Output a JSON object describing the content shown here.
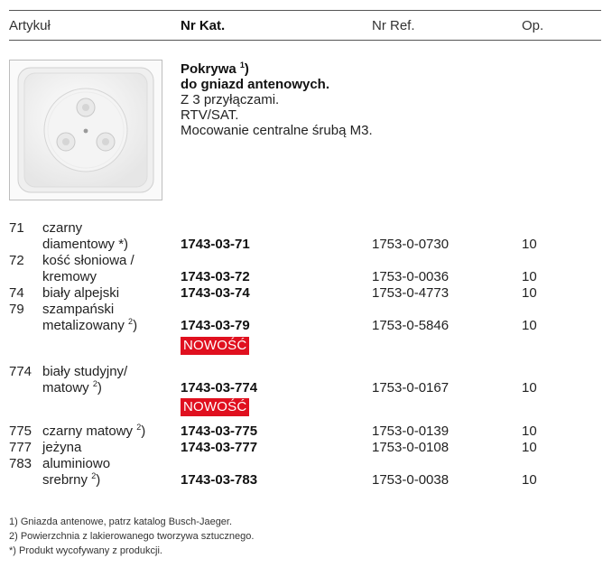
{
  "header": {
    "col_article": "Artykuł",
    "col_cat": "Nr Kat.",
    "col_ref": "Nr Ref.",
    "col_op": "Op."
  },
  "product": {
    "title": "Pokrywa",
    "title_sup": "1",
    "title_paren": ")",
    "subtitle": "do gniazd antenowych.",
    "line1": "Z 3 przyłączami.",
    "line2": "RTV/SAT.",
    "line3": "Mocowanie centralne śrubą M3."
  },
  "rows": [
    {
      "num": "71",
      "name1": "czarny",
      "name2": "diamentowy *)",
      "cat": "1743-03-71",
      "ref": "1753-0-0730",
      "op": "10"
    },
    {
      "num": "72",
      "name1": "kość słoniowa /",
      "name2": "kremowy",
      "cat": "1743-03-72",
      "ref": "1753-0-0036",
      "op": "10"
    },
    {
      "num": "74",
      "name1": "biały alpejski",
      "cat": "1743-03-74",
      "ref": "1753-0-4773",
      "op": "10"
    },
    {
      "num": "79",
      "name1": "szampański",
      "name2": "metalizowany",
      "name2_sup": "2",
      "name2_after": ")",
      "cat": "1743-03-79",
      "ref": "1753-0-5846",
      "op": "10"
    },
    {
      "num": "774",
      "name1": "biały studyjny/",
      "name2": "matowy",
      "name2_sup": "2",
      "name2_after": ")",
      "cat": "1743-03-774",
      "ref": "1753-0-0167",
      "op": "10"
    },
    {
      "num": "775",
      "name1": "czarny matowy",
      "name1_sup": "2",
      "name1_after": ")",
      "cat": "1743-03-775",
      "ref": "1753-0-0139",
      "op": "10"
    },
    {
      "num": "777",
      "name1": "jeżyna",
      "cat": "1743-03-777",
      "ref": "1753-0-0108",
      "op": "10"
    },
    {
      "num": "783",
      "name1": "aluminiowo",
      "name2": "srebrny",
      "name2_sup": "2",
      "name2_after": ")",
      "cat": "1743-03-783",
      "ref": "1753-0-0038",
      "op": "10"
    }
  ],
  "badges": [
    "NOWOŚĆ",
    "NOWOŚĆ"
  ],
  "footnotes": [
    "1)  Gniazda antenowe, patrz katalog Busch-Jaeger.",
    "2)  Powierzchnia z lakierowanego tworzywa sztucznego.",
    "*)  Produkt wycofywany z produkcji."
  ],
  "colors": {
    "badge_bg": "#e0101f",
    "badge_text": "#ffffff",
    "rule": "#555555"
  }
}
